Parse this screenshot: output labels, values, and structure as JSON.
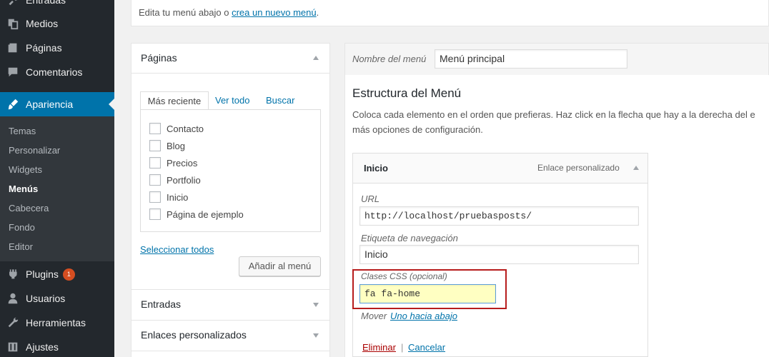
{
  "sidebar": {
    "top_partial": "Entradas",
    "items": [
      {
        "label": "Medios",
        "icon": "media-icon"
      },
      {
        "label": "Páginas",
        "icon": "pages-icon"
      },
      {
        "label": "Comentarios",
        "icon": "comments-icon"
      },
      {
        "label": "Apariencia",
        "icon": "appearance-icon"
      },
      {
        "label": "Plugins",
        "icon": "plugins-icon",
        "badge": "1"
      },
      {
        "label": "Usuarios",
        "icon": "users-icon"
      },
      {
        "label": "Herramientas",
        "icon": "tools-icon"
      },
      {
        "label": "Ajustes",
        "icon": "settings-icon"
      }
    ],
    "submenu": [
      "Temas",
      "Personalizar",
      "Widgets",
      "Menús",
      "Cabecera",
      "Fondo",
      "Editor"
    ]
  },
  "top_note": {
    "text": "Edita tu menú abajo o ",
    "link": "crea un nuevo menú",
    "suffix": "."
  },
  "pages_panel": {
    "title": "Páginas",
    "tabs": [
      "Más reciente",
      "Ver todo",
      "Buscar"
    ],
    "items": [
      "Contacto",
      "Blog",
      "Precios",
      "Portfolio",
      "Inicio",
      "Página de ejemplo"
    ],
    "select_all": "Seleccionar todos",
    "add_button": "Añadir al menú"
  },
  "collapsed_panels": [
    "Entradas",
    "Enlaces personalizados"
  ],
  "menu_name": {
    "label": "Nombre del menú",
    "value": "Menú principal"
  },
  "structure": {
    "title": "Estructura del Menú",
    "line1": "Coloca cada elemento en el orden que prefieras. Haz click en la flecha que hay a la derecha del e",
    "line2": "más opciones de configuración."
  },
  "menu_item": {
    "title": "Inicio",
    "type": "Enlace personalizado",
    "url_label": "URL",
    "url_value": "http://localhost/pruebasposts/",
    "nav_label": "Etiqueta de navegación",
    "nav_value": "Inicio",
    "css_label": "Clases CSS (opcional)",
    "css_value": "fa fa-home",
    "move_label": "Mover",
    "move_link": "Uno hacia abajo",
    "delete": "Eliminar",
    "separator": "|",
    "cancel": "Cancelar"
  },
  "colors": {
    "accent": "#0073aa",
    "highlight_border": "#b71c1c",
    "css_input_bg": "#ffffc2",
    "delete_red": "#a00"
  }
}
